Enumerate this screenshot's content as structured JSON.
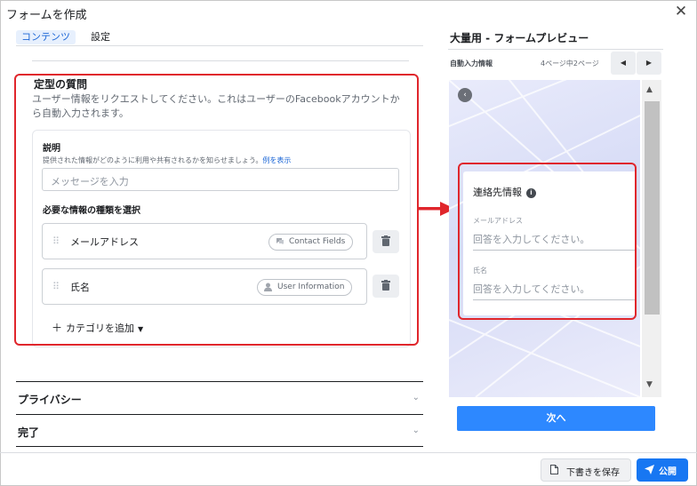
{
  "window": {
    "title": "フォームを作成",
    "close_icon": "close-icon"
  },
  "tabs": [
    {
      "label": "コンテンツ",
      "active": true
    },
    {
      "label": "設定",
      "active": false
    }
  ],
  "section": {
    "title": "定型の質問",
    "description": "ユーザー情報をリクエストしてください。これはユーザーのFacebookアカウントから自動入力されます。",
    "explain_label": "説明",
    "explain_hint": "提供された情報がどのように利用や共有されるかを知らせましょう。",
    "example_link": "例を表示",
    "message_placeholder": "メッセージを入力",
    "info_type_label": "必要な情報の種類を選択",
    "fields": [
      {
        "name": "メールアドレス",
        "category": "Contact Fields"
      },
      {
        "name": "氏名",
        "category": "User Information"
      }
    ],
    "add_category": "カテゴリを追加"
  },
  "accordions": [
    {
      "label": "プライバシー"
    },
    {
      "label": "完了"
    }
  ],
  "preview": {
    "title": "大量用 - フォームプレビュー",
    "subtitle": "自動入力情報",
    "page_indicator": "4ページ中2ページ",
    "card_title": "連絡先情報",
    "email_label": "メールアドレス",
    "email_placeholder": "回答を入力してください。",
    "name_label": "氏名",
    "name_placeholder": "回答を入力してください。",
    "next_button": "次へ"
  },
  "footer": {
    "save_draft": "下書きを保存",
    "publish": "公開"
  },
  "colors": {
    "accent": "#1877f2",
    "annotation_red": "#e0262c",
    "next_button": "#2d88ff"
  }
}
